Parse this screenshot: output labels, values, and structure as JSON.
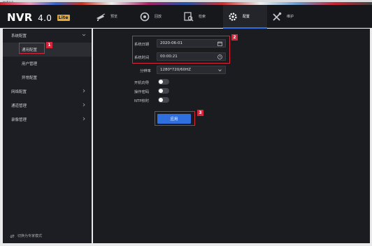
{
  "window": {
    "title": "NVR4.0"
  },
  "brand": {
    "name": "NVR",
    "version": "4.0",
    "badge": "Lite"
  },
  "nav": [
    {
      "label": "预览",
      "icon": "camera-icon",
      "active": false
    },
    {
      "label": "回放",
      "icon": "playback-icon",
      "active": false
    },
    {
      "label": "检索",
      "icon": "search-icon",
      "active": false
    },
    {
      "label": "配置",
      "icon": "gear-icon",
      "active": true
    },
    {
      "label": "维护",
      "icon": "tools-icon",
      "active": false
    }
  ],
  "sidebar": {
    "items": [
      {
        "label": "系统配置",
        "expanded": true
      },
      {
        "label": "通用配置",
        "selected": true
      },
      {
        "label": "用户管理"
      },
      {
        "label": "异常配置"
      },
      {
        "label": "网络配置"
      },
      {
        "label": "通道管理"
      },
      {
        "label": "录像管理"
      }
    ],
    "footer": "切换为专家模式"
  },
  "form": {
    "date_label": "系统日期",
    "date_value": "2020-06-01",
    "time_label": "系统时间",
    "time_value": "00:00:21",
    "resolution_label": "分辨率",
    "resolution_value": "1280*720/60HZ",
    "boot_wizard_label": "开机向导",
    "op_password_label": "操作密码",
    "ntp_label": "NTP校时",
    "apply_label": "应用"
  },
  "annotations": {
    "tag1": "1",
    "tag2": "2",
    "tag3": "3"
  },
  "colors": {
    "accent": "#2f6fe0",
    "highlight": "#d6263a",
    "panel": "#1b1c20",
    "sidebar": "#1d1e23"
  }
}
